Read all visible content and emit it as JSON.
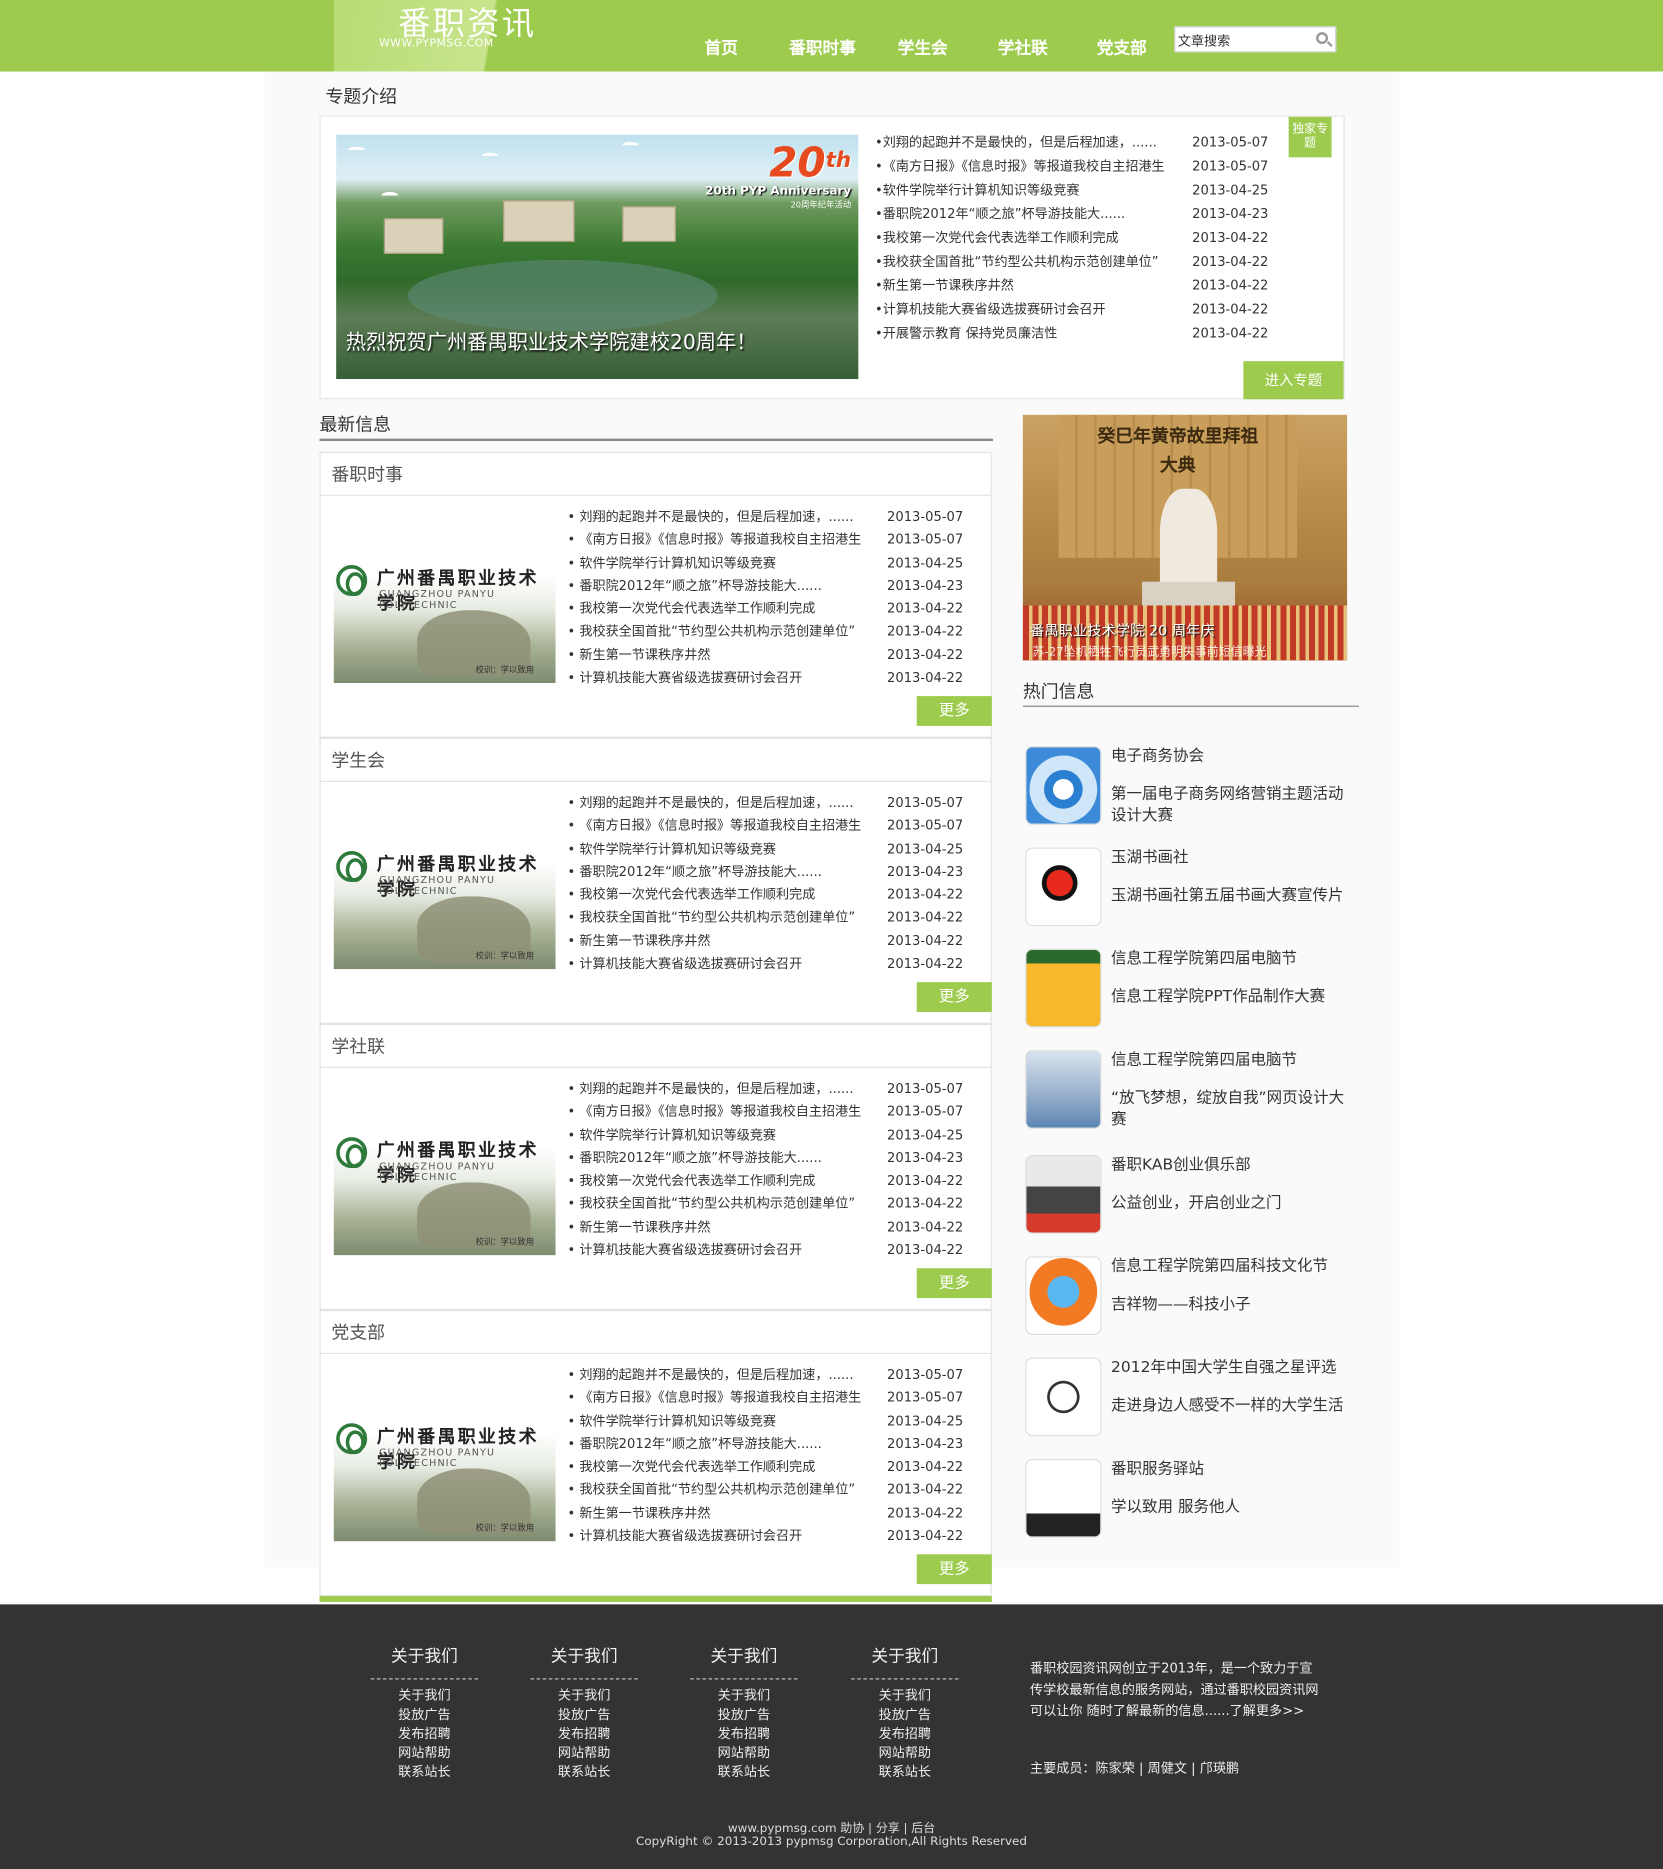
{
  "header": {
    "logo_text": "番职资讯",
    "logo_url": "WWW.PYPMSG.COM",
    "nav": [
      "首页",
      "番职时事",
      "学生会",
      "学社联",
      "党支部"
    ],
    "search_placeholder": "文章搜索"
  },
  "feature": {
    "section_title": "专题介绍",
    "banner_caption": "热烈祝贺广州番禺职业技术学院建校20周年！",
    "banner_number": "20",
    "banner_suffix": "th",
    "banner_title": "20th PYP Anniversary",
    "banner_sub": "20周年纪年活动",
    "tag": "独家专题",
    "button": "进入专题",
    "items": [
      {
        "t": "•刘翔的起跑并不是最快的，但是后程加速，......",
        "d": "2013-05-07"
      },
      {
        "t": "•《南方日报》《信息时报》等报道我校自主招港生",
        "d": "2013-05-07"
      },
      {
        "t": "•软件学院举行计算机知识等级竞赛",
        "d": "2013-04-25"
      },
      {
        "t": "•番职院2012年“顺之旅”杯导游技能大......",
        "d": "2013-04-23"
      },
      {
        "t": "•我校第一次党代会代表选举工作顺利完成",
        "d": "2013-04-22"
      },
      {
        "t": "•我校获全国首批“节约型公共机构示范创建单位”",
        "d": "2013-04-22"
      },
      {
        "t": "•新生第一节课秩序井然",
        "d": "2013-04-22"
      },
      {
        "t": "•计算机技能大赛省级选拔赛研讨会召开",
        "d": "2013-04-22"
      },
      {
        "t": "•开展警示教育 保持党员廉洁性",
        "d": "2013-04-22"
      }
    ]
  },
  "latest": {
    "section_title": "最新信息",
    "more_label": "更多",
    "school_logo": {
      "cn": "广州番禺职业技术学院",
      "en": "GUANGZHOU PANYU POLYTECHNIC",
      "motto": "校训：学以致用"
    },
    "boxes": [
      "番职时事",
      "学生会",
      "学社联",
      "党支部"
    ],
    "items": [
      {
        "t": "• 刘翔的起跑并不是最快的，但是后程加速，......",
        "d": "2013-05-07"
      },
      {
        "t": "• 《南方日报》《信息时报》等报道我校自主招港生",
        "d": "2013-05-07"
      },
      {
        "t": "• 软件学院举行计算机知识等级竞赛",
        "d": "2013-04-25"
      },
      {
        "t": "• 番职院2012年“顺之旅”杯导游技能大......",
        "d": "2013-04-23"
      },
      {
        "t": "• 我校第一次党代会代表选举工作顺利完成",
        "d": "2013-04-22"
      },
      {
        "t": "• 我校获全国首批“节约型公共机构示范创建单位”",
        "d": "2013-04-22"
      },
      {
        "t": "• 新生第一节课秩序井然",
        "d": "2013-04-22"
      },
      {
        "t": "• 计算机技能大赛省级选拔赛研讨会召开",
        "d": "2013-04-22"
      }
    ]
  },
  "side_banner": {
    "sign": "癸巳年黄帝故里拜祖大典",
    "caption": "番禺职业技术学院 20 周年庆",
    "sub": "苏-27坠机牺牲飞行员武勇明失事前短信曝光"
  },
  "hot": {
    "title": "热门信息",
    "items": [
      {
        "icon": "ecommerce-icon",
        "title": "电子商务协会",
        "desc": "第一届电子商务网络营销主题活动设计大赛"
      },
      {
        "icon": "calligraphy-icon",
        "title": "玉湖书画社",
        "desc": "玉湖书画社第五届书画大赛宣传片"
      },
      {
        "icon": "ppt-poster-icon",
        "title": "信息工程学院第四届电脑节",
        "desc": "信息工程学院PPT作品制作大赛"
      },
      {
        "icon": "web-poster-icon",
        "title": "信息工程学院第四届电脑节",
        "desc": "“放飞梦想，绽放自我”网页设计大赛"
      },
      {
        "icon": "kab-icon",
        "title": "番职KAB创业俱乐部",
        "desc": "公益创业，开启创业之门"
      },
      {
        "icon": "mascot-icon",
        "title": "信息工程学院第四届科技文化节",
        "desc": "吉祥物——科技小子"
      },
      {
        "icon": "comic-icon",
        "title": "2012年中国大学生自强之星评选",
        "desc": "走进身边人感受不一样的大学生活"
      },
      {
        "icon": "service-station-icon",
        "title": "番职服务驿站",
        "desc": "学以致用   服务他人"
      }
    ]
  },
  "footer": {
    "columns": [
      {
        "title": "关于我们",
        "links": [
          "关于我们",
          "投放广告",
          "发布招聘",
          "网站帮助",
          "联系站长"
        ]
      },
      {
        "title": "关于我们",
        "links": [
          "关于我们",
          "投放广告",
          "发布招聘",
          "网站帮助",
          "联系站长"
        ]
      },
      {
        "title": "关于我们",
        "links": [
          "关于我们",
          "投放广告",
          "发布招聘",
          "网站帮助",
          "联系站长"
        ]
      },
      {
        "title": "关于我们",
        "links": [
          "关于我们",
          "投放广告",
          "发布招聘",
          "网站帮助",
          "联系站长"
        ]
      }
    ],
    "description": "番职校园资讯网创立于2013年，是一个致力于宣传学校最新信息的服务网站，通过番职校园资讯网可以让你 随时了解最新的信息......了解更多>>",
    "members": "主要成员：陈家荣 | 周健文 | 邝瑛鹏",
    "links_line": "www.pypmsg.com 助协 | 分享 | 后台",
    "copyright": "CopyRight © 2013-2013 pypmsg Corporation,All Rights Reserved"
  },
  "colors": {
    "accent": "#9dcb4d",
    "footer_bg": "#333333"
  }
}
